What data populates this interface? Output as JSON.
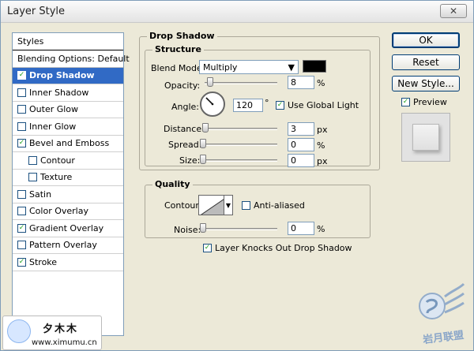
{
  "window": {
    "title": "Layer Style",
    "close_label": "✕"
  },
  "styles_panel": {
    "header": "Styles",
    "items": [
      {
        "label": "Blending Options: Default",
        "checked": null
      },
      {
        "label": "Drop Shadow",
        "checked": true
      },
      {
        "label": "Inner Shadow",
        "checked": false
      },
      {
        "label": "Outer Glow",
        "checked": false
      },
      {
        "label": "Inner Glow",
        "checked": false
      },
      {
        "label": "Bevel and Emboss",
        "checked": true
      },
      {
        "label": "Contour",
        "checked": false
      },
      {
        "label": "Texture",
        "checked": false
      },
      {
        "label": "Satin",
        "checked": false
      },
      {
        "label": "Color Overlay",
        "checked": false
      },
      {
        "label": "Gradient Overlay",
        "checked": true
      },
      {
        "label": "Pattern Overlay",
        "checked": false
      },
      {
        "label": "Stroke",
        "checked": true
      }
    ]
  },
  "drop_shadow": {
    "section_title": "Drop Shadow",
    "structure_title": "Structure",
    "blend_mode_label": "Blend Mode:",
    "blend_mode_value": "Multiply",
    "color": "#000000",
    "opacity_label": "Opacity:",
    "opacity_value": "8",
    "opacity_unit": "%",
    "angle_label": "Angle:",
    "angle_value": "120",
    "angle_unit": "°",
    "use_global_light_label": "Use Global Light",
    "distance_label": "Distance:",
    "distance_value": "3",
    "distance_unit": "px",
    "spread_label": "Spread:",
    "spread_value": "0",
    "spread_unit": "%",
    "size_label": "Size:",
    "size_value": "0",
    "size_unit": "px",
    "quality_title": "Quality",
    "contour_label": "Contour:",
    "anti_aliased_label": "Anti-aliased",
    "noise_label": "Noise:",
    "noise_value": "0",
    "noise_unit": "%",
    "knockout_label": "Layer Knocks Out Drop Shadow"
  },
  "buttons": {
    "ok": "OK",
    "reset": "Reset",
    "new_style": "New Style...",
    "preview": "Preview"
  },
  "branding": {
    "logo_chinese": "夕木木",
    "logo_url": "www.ximumu.cn",
    "watermark_text": "岩月联盟"
  },
  "colors": {
    "selected_bg": "#316ac5",
    "window_bg": "#ece9d8"
  }
}
